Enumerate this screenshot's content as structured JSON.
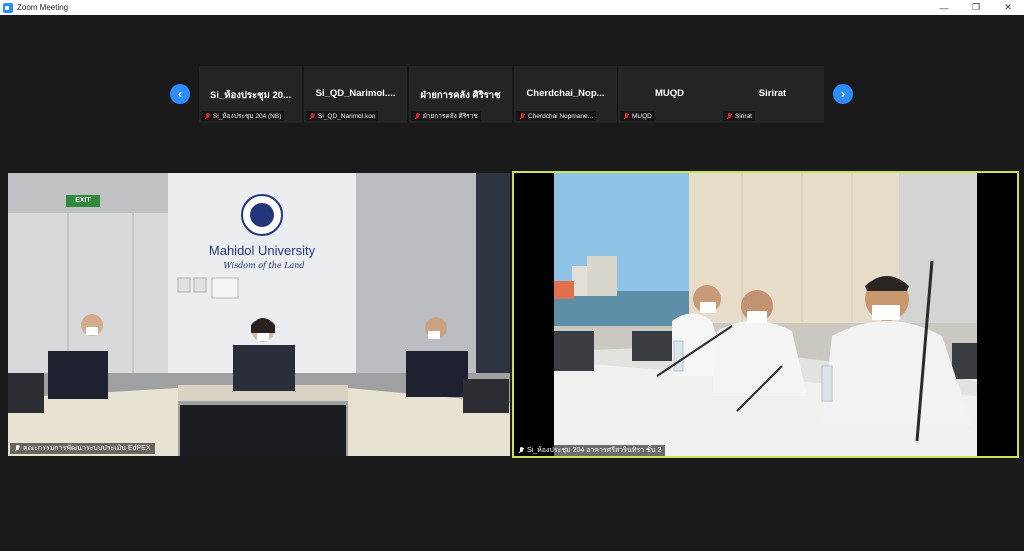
{
  "window": {
    "title": "Zoom Meeting",
    "controls": [
      "—",
      "❐",
      "✕"
    ]
  },
  "strip": {
    "prev_icon": "chevron-left-icon",
    "next_icon": "chevron-right-icon",
    "participants": [
      {
        "name": "Si_ห้องประชุม 20...",
        "label": "Si_ห้องประชุม 204 (NB)"
      },
      {
        "name": "Si_QD_Narimol....",
        "label": "Si_QD_Narimol.kon"
      },
      {
        "name": "ฝ่ายการคลัง ศิริราช",
        "label": "ฝ่ายการคลัง ศิริราช"
      },
      {
        "name": "Cherdchai_Nop...",
        "label": "Cherdchai Nopmane..."
      },
      {
        "name": "MUQD",
        "label": "MUQD"
      },
      {
        "name": "Sirirat",
        "label": "Sirirat"
      }
    ]
  },
  "main": {
    "left": {
      "label": "คณะกรรมการพัฒนาระบบประเมิน EdPEX",
      "wall_title": "Mahidol University",
      "wall_slogan": "Wisdom of the Land",
      "exit_sign": "EXIT"
    },
    "right": {
      "label": "Si_ห้องประชุม 204 อาคารศรีสวรินทิรา ชั้น 2"
    }
  },
  "colors": {
    "accent": "#2d8cff",
    "active_border": "#c6e35a",
    "muted_mic": "#e02828"
  }
}
